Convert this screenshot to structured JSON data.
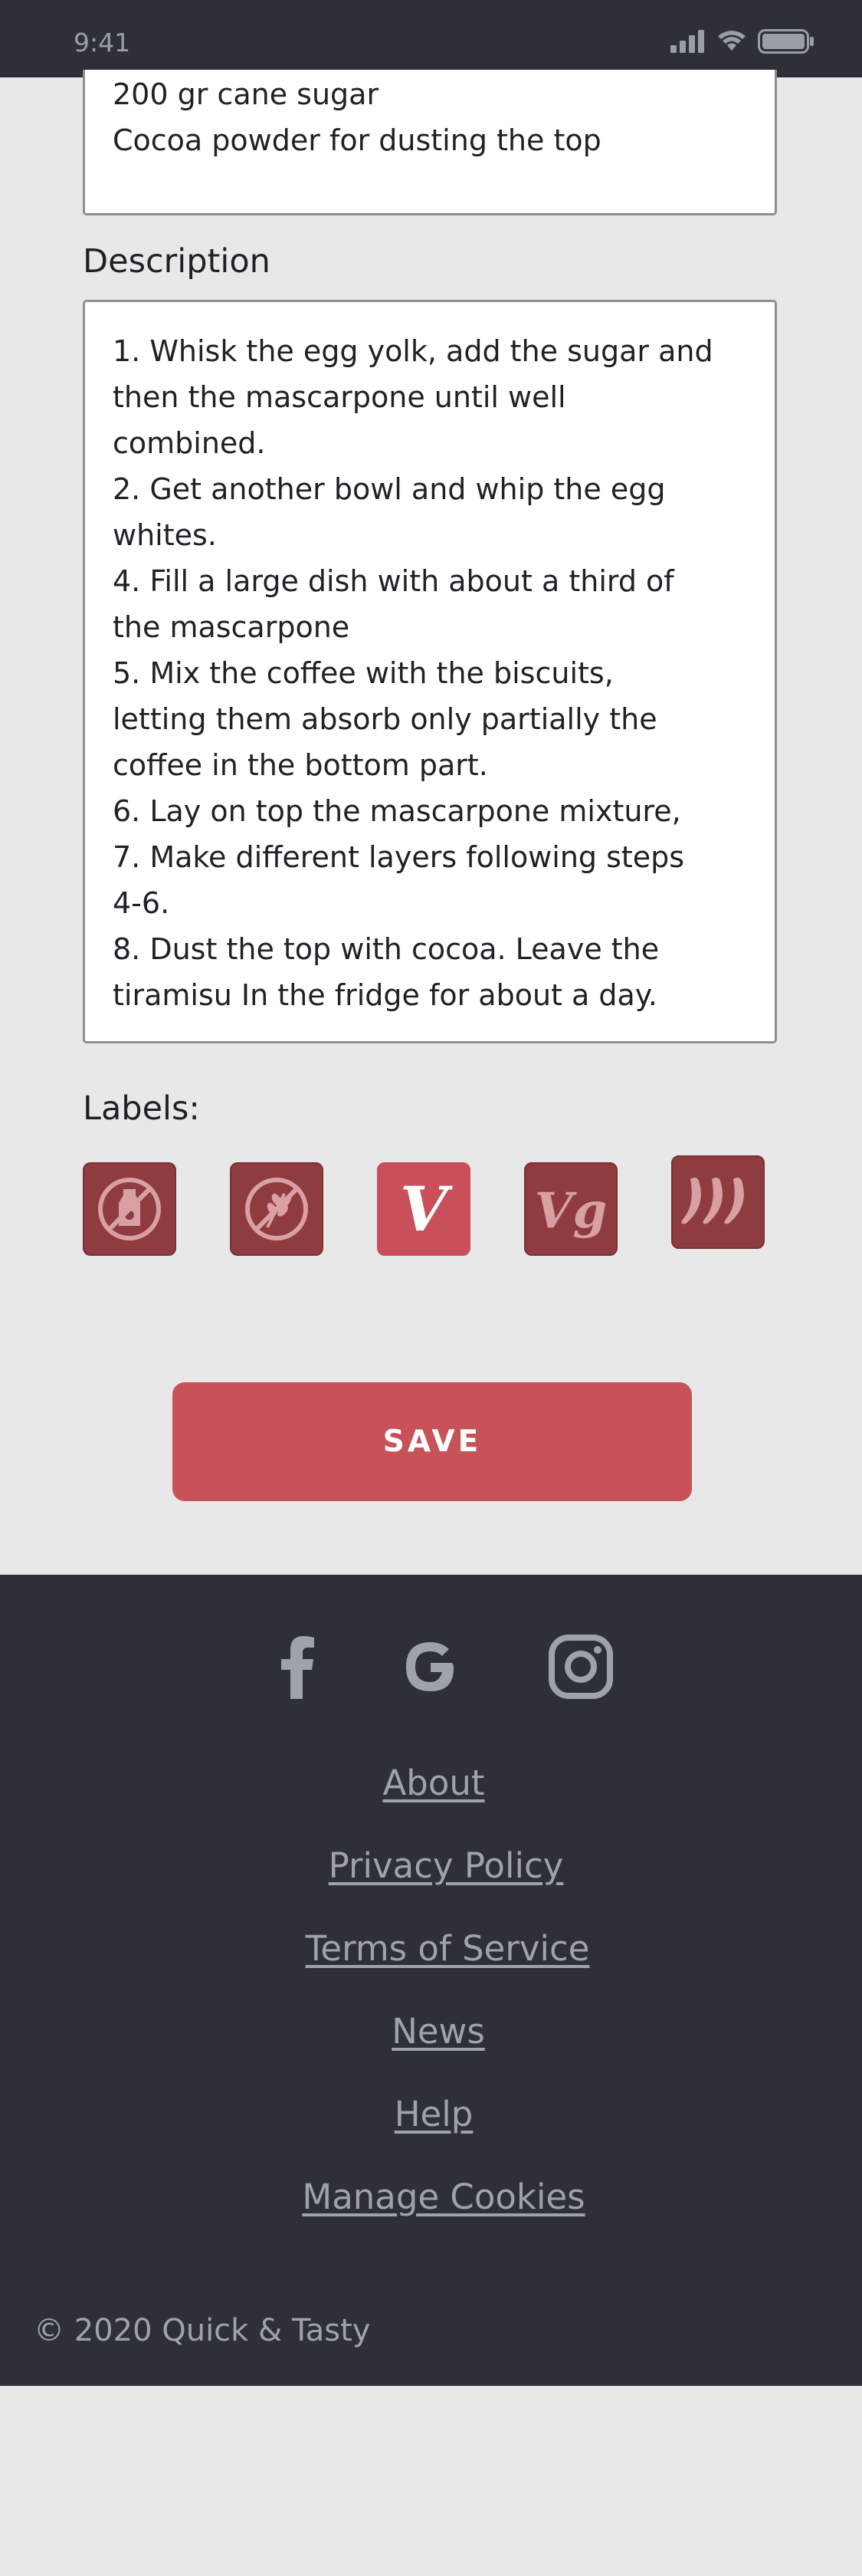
{
  "status_bar": {
    "time": "9:41",
    "icons": [
      "signal-icon",
      "wifi-icon",
      "battery-icon"
    ]
  },
  "ingredients": {
    "lines": [
      "200 gr cane sugar",
      "Cocoa powder for dusting the top"
    ]
  },
  "description": {
    "label": "Description",
    "lines": [
      "1. Whisk the egg yolk, add the sugar and",
      "then the mascarpone until well",
      "combined.",
      "2.  Get another bowl and whip the egg",
      "whites.",
      "4. Fill a large dish with about a third of",
      "the mascarpone",
      "5. Mix the coffee with the biscuits,",
      "letting them absorb only partially the",
      "coffee in the bottom part.",
      "6.  Lay on top the mascarpone mixture,",
      "7. Make different layers following steps",
      "4-6.",
      "8. Dust the top with cocoa. Leave the",
      "tiramisu In the fridge for about a day."
    ]
  },
  "labels": {
    "title": "Labels:",
    "items": [
      {
        "icon": "no-dairy-icon",
        "active": false
      },
      {
        "icon": "no-gluten-icon",
        "active": false
      },
      {
        "icon": "vegetarian-icon",
        "active": true,
        "text": "V"
      },
      {
        "icon": "vegan-icon",
        "active": false,
        "text": "Vg"
      },
      {
        "icon": "spicy-icon",
        "active": false
      }
    ]
  },
  "save_button": {
    "label": "SAVE"
  },
  "footer": {
    "social": [
      "facebook-icon",
      "google-icon",
      "instagram-icon"
    ],
    "links": [
      "About",
      "Privacy Policy",
      "Terms of Service",
      "News",
      "Help",
      "Manage Cookies"
    ],
    "copyright": "© 2020 Quick & Tasty"
  },
  "colors": {
    "dark_bg": "#2d3037",
    "page_bg": "#e8e8e8",
    "accent": "#c75257",
    "label_inactive": "#8f3c41",
    "footer_text": "#9ea2aa"
  }
}
